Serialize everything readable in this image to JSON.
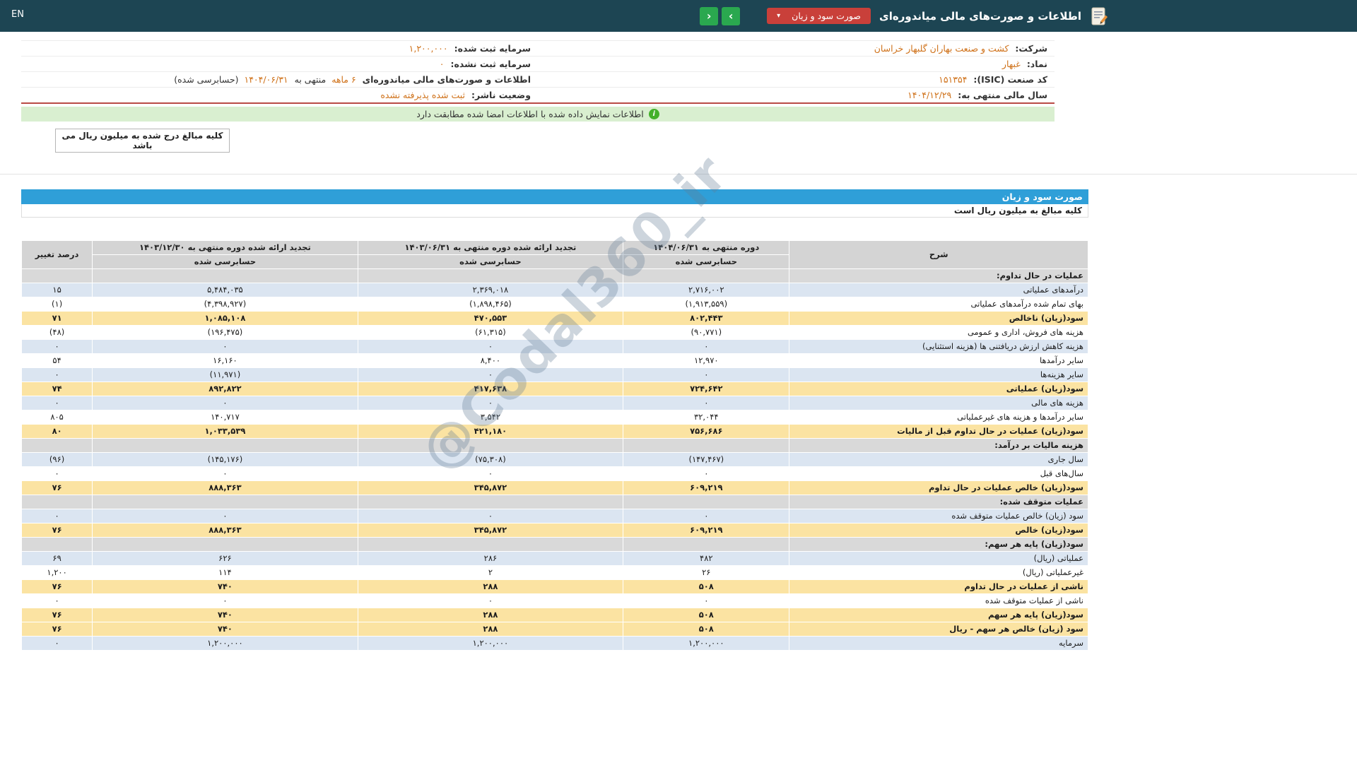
{
  "header": {
    "en_label": "EN",
    "title": "اطلاعات و صورت‌های مالی میاندوره‌ای",
    "report_select_label": "صورت سود و زیان",
    "select_caret": "▾",
    "nav_next_glyph": "‹",
    "nav_prev_glyph": "›"
  },
  "company_info": {
    "company_label": "شرکت:",
    "company_value": "کشت و صنعت بهاران گلبهار خراسان",
    "registered_capital_label": "سرمایه ثبت شده:",
    "registered_capital_value": "۱,۲۰۰,۰۰۰",
    "symbol_label": "نماد:",
    "symbol_value": "غبهار",
    "unregistered_capital_label": "سرمایه ثبت نشده:",
    "unregistered_capital_value": "۰",
    "isic_label": "کد صنعت (ISIC):",
    "isic_value": "۱۵۱۳۵۴",
    "period_statement_label": "اطلاعات و صورت‌های مالی میاندوره‌ای",
    "period_months": "۶ ماهه",
    "period_connector": "منتهی به",
    "period_date": "۱۴۰۴/۰۶/۳۱",
    "period_audit_note": "(حسابرسی شده)",
    "fiscal_year_label": "سال مالی منتهی به:",
    "fiscal_year_value": "۱۴۰۴/۱۲/۲۹",
    "publisher_status_label": "وضعیت ناشر:",
    "publisher_status_value": "ثبت شده پذیرفته نشده"
  },
  "banner": {
    "icon_glyph": "i",
    "text": "اطلاعات نمایش داده شده با اطلاعات امضا شده مطابقت دارد"
  },
  "note_box": {
    "text": "کلیه مبالغ درج شده به میلیون ریال می باشد"
  },
  "statement": {
    "title": "صورت سود و زیان",
    "unit_note": "کلیه مبالغ به میلیون ریال است"
  },
  "watermark": "@Codal360_ir",
  "colors": {
    "header_teal": "#1d4553",
    "title_blue": "#2f9fd8",
    "accent_orange": "#cf7119",
    "negative_red": "#c0392b",
    "highlight_yellow": "#fbe3a2",
    "row_blue": "#dbe5f1",
    "success_green": "#43b02a",
    "select_red": "#c9403a",
    "nav_green": "#2aa84f"
  },
  "table": {
    "headers": {
      "description": "شرح",
      "period_current": "دوره منتهی به ۱۴۰۴/۰۶/۳۱",
      "period_restated_mid": "تجدید ارائه شده دوره منتهی به ۱۴۰۳/۰۶/۳۱",
      "period_restated_year": "تجدید ارائه شده دوره منتهی به ۱۴۰۳/۱۲/۳۰",
      "audited": "حسابرسی شده",
      "percent_change": "درصد تغییر"
    },
    "rows": [
      {
        "type": "section",
        "label": "عملیات در حال تداوم:"
      },
      {
        "type": "data",
        "style": "blue",
        "label": "درآمدهای عملیاتی",
        "current": "۲,۷۱۶,۰۰۲",
        "restated_mid": "۲,۳۶۹,۰۱۸",
        "restated_year": "۵,۴۸۴,۰۳۵",
        "change": "۱۵"
      },
      {
        "type": "data",
        "style": "white",
        "label": "بهای تمام شده درآمدهای عملیاتی",
        "current": "(۱,۹۱۳,۵۵۹)",
        "restated_mid": "(۱,۸۹۸,۴۶۵)",
        "restated_year": "(۴,۳۹۸,۹۲۷)",
        "change": "(۱)"
      },
      {
        "type": "data",
        "style": "yellow",
        "label": "سود(زیان) ناخالص",
        "current": "۸۰۲,۴۴۳",
        "restated_mid": "۴۷۰,۵۵۳",
        "restated_year": "۱,۰۸۵,۱۰۸",
        "change": "۷۱"
      },
      {
        "type": "data",
        "style": "white",
        "label": "هزینه های فروش، اداری و عمومی",
        "current": "(۹۰,۷۷۱)",
        "restated_mid": "(۶۱,۳۱۵)",
        "restated_year": "(۱۹۶,۴۷۵)",
        "change": "(۴۸)"
      },
      {
        "type": "data",
        "style": "blue",
        "label": "هزینه کاهش ارزش دریافتنی ها (هزینه استثنایی)",
        "current": "۰",
        "restated_mid": "۰",
        "restated_year": "۰",
        "change": "۰"
      },
      {
        "type": "data",
        "style": "white",
        "label": "سایر درآمدها",
        "current": "۱۲,۹۷۰",
        "restated_mid": "۸,۴۰۰",
        "restated_year": "۱۶,۱۶۰",
        "change": "۵۴"
      },
      {
        "type": "data",
        "style": "blue",
        "label": "سایر هزینه‌ها",
        "current": "۰",
        "restated_mid": "۰",
        "restated_year": "(۱۱,۹۷۱)",
        "change": "۰"
      },
      {
        "type": "data",
        "style": "yellow",
        "label": "سود(زیان) عملیاتی",
        "current": "۷۲۴,۶۴۲",
        "restated_mid": "۴۱۷,۶۳۸",
        "restated_year": "۸۹۲,۸۲۲",
        "change": "۷۴"
      },
      {
        "type": "data",
        "style": "blue",
        "label": "هزینه های مالی",
        "current": "۰",
        "restated_mid": "۰",
        "restated_year": "۰",
        "change": "۰"
      },
      {
        "type": "data",
        "style": "white",
        "label": "سایر درآمدها و هزینه های غیرعملیاتی",
        "current": "۳۲,۰۴۴",
        "restated_mid": "۳,۵۴۲",
        "restated_year": "۱۴۰,۷۱۷",
        "change": "۸۰۵"
      },
      {
        "type": "data",
        "style": "yellow",
        "label": "سود(زیان) عملیات در حال تداوم قبل از مالیات",
        "current": "۷۵۶,۶۸۶",
        "restated_mid": "۴۲۱,۱۸۰",
        "restated_year": "۱,۰۳۳,۵۳۹",
        "change": "۸۰"
      },
      {
        "type": "section",
        "label": "هزینه مالیات بر درآمد:"
      },
      {
        "type": "data",
        "style": "blue",
        "label": "سال جاری",
        "current": "(۱۴۷,۴۶۷)",
        "restated_mid": "(۷۵,۳۰۸)",
        "restated_year": "(۱۴۵,۱۷۶)",
        "change": "(۹۶)"
      },
      {
        "type": "data",
        "style": "white",
        "label": "سال‌های قبل",
        "current": "۰",
        "restated_mid": "۰",
        "restated_year": "۰",
        "change": "۰"
      },
      {
        "type": "data",
        "style": "yellow",
        "label": "سود(زیان) خالص عملیات در حال تداوم",
        "current": "۶۰۹,۲۱۹",
        "restated_mid": "۳۴۵,۸۷۲",
        "restated_year": "۸۸۸,۳۶۳",
        "change": "۷۶"
      },
      {
        "type": "section",
        "label": "عملیات متوقف شده:"
      },
      {
        "type": "data",
        "style": "blue",
        "label": "سود (زیان) خالص عملیات متوقف شده",
        "current": "۰",
        "restated_mid": "۰",
        "restated_year": "۰",
        "change": "۰"
      },
      {
        "type": "data",
        "style": "yellow",
        "label": "سود(زیان) خالص",
        "current": "۶۰۹,۲۱۹",
        "restated_mid": "۳۴۵,۸۷۲",
        "restated_year": "۸۸۸,۳۶۳",
        "change": "۷۶"
      },
      {
        "type": "section",
        "label": "سود(زیان) پایه هر سهم:"
      },
      {
        "type": "data",
        "style": "blue",
        "label": "عملیاتی (ریال)",
        "current": "۴۸۲",
        "restated_mid": "۲۸۶",
        "restated_year": "۶۲۶",
        "change": "۶۹"
      },
      {
        "type": "data",
        "style": "white",
        "label": "غیرعملیاتی (ریال)",
        "current": "۲۶",
        "restated_mid": "۲",
        "restated_year": "۱۱۴",
        "change": "۱,۲۰۰"
      },
      {
        "type": "data",
        "style": "yellow",
        "label": "ناشی از عملیات در حال تداوم",
        "current": "۵۰۸",
        "restated_mid": "۲۸۸",
        "restated_year": "۷۴۰",
        "change": "۷۶"
      },
      {
        "type": "data",
        "style": "white",
        "label": "ناشی از عملیات متوقف شده",
        "current": "۰",
        "restated_mid": "۰",
        "restated_year": "۰",
        "change": "۰"
      },
      {
        "type": "data",
        "style": "yellow",
        "label": "سود(زیان) پایه هر سهم",
        "current": "۵۰۸",
        "restated_mid": "۲۸۸",
        "restated_year": "۷۴۰",
        "change": "۷۶"
      },
      {
        "type": "data",
        "style": "yellow",
        "label": "سود (زیان) خالص هر سهم - ریال",
        "current": "۵۰۸",
        "restated_mid": "۲۸۸",
        "restated_year": "۷۴۰",
        "change": "۷۶"
      },
      {
        "type": "data",
        "style": "blue",
        "label": "سرمایه",
        "current": "۱,۲۰۰,۰۰۰",
        "restated_mid": "۱,۲۰۰,۰۰۰",
        "restated_year": "۱,۲۰۰,۰۰۰",
        "change": "۰"
      }
    ]
  }
}
